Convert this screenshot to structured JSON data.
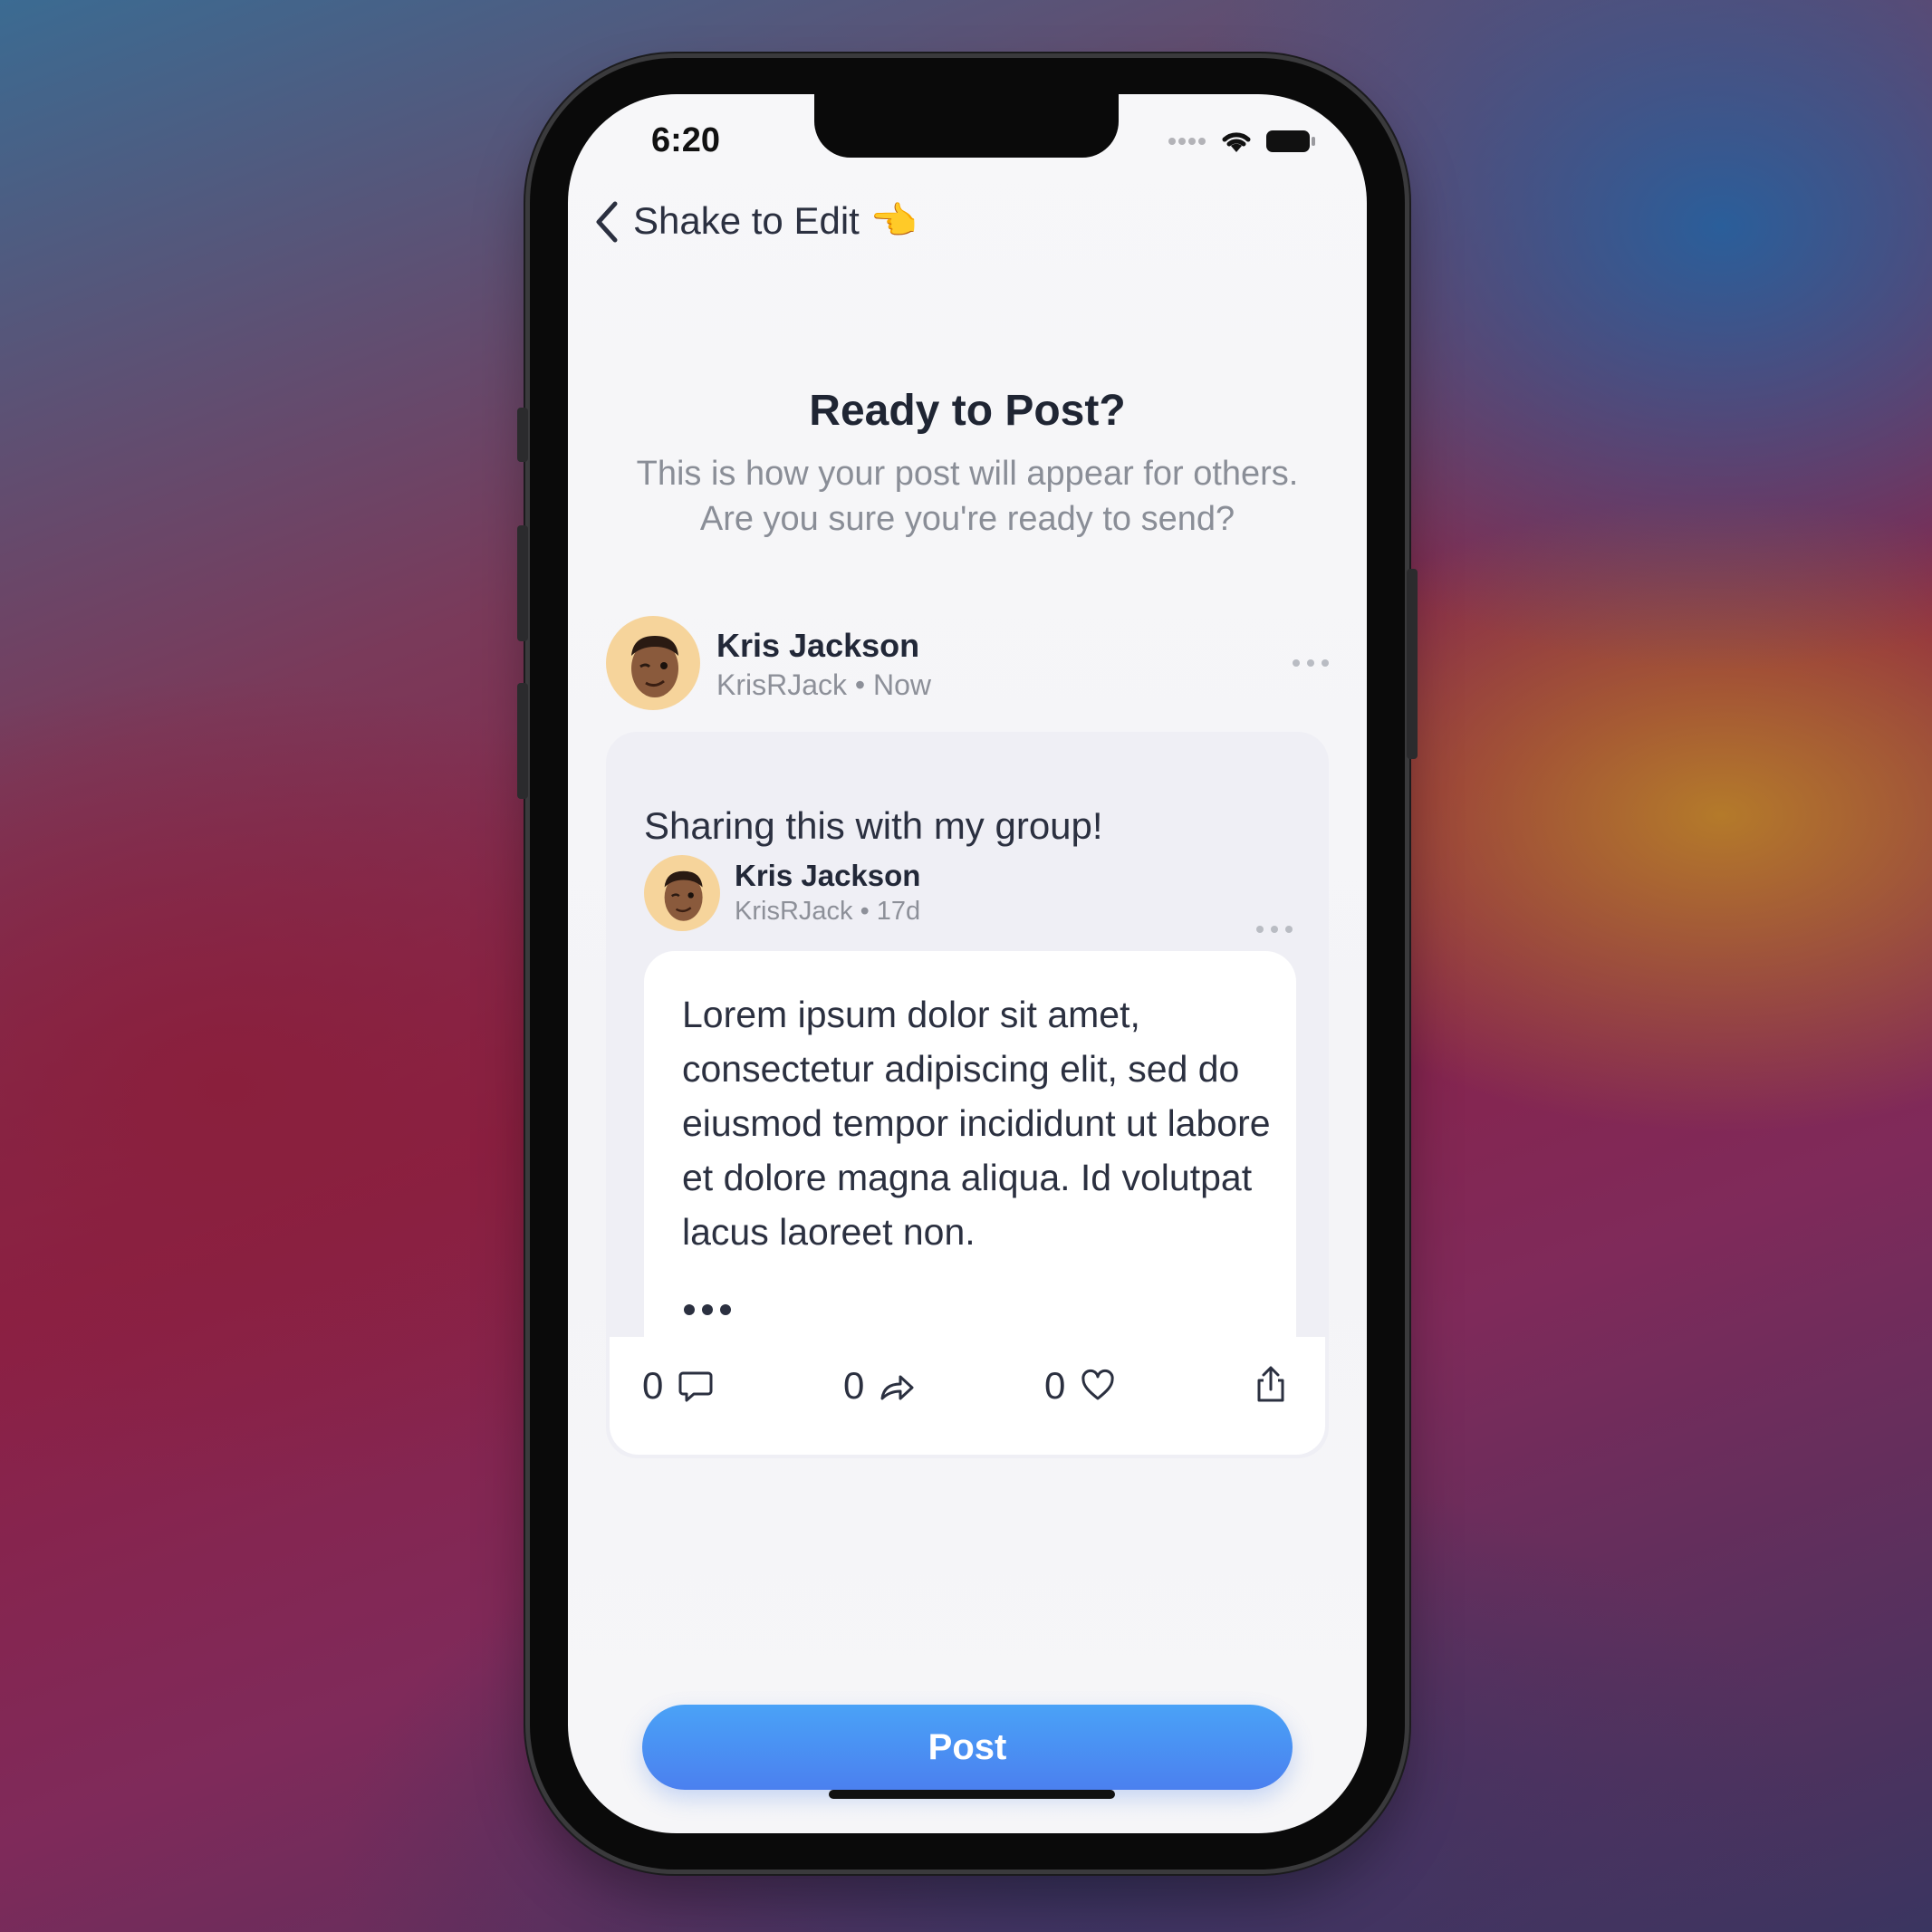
{
  "status": {
    "time": "6:20"
  },
  "nav": {
    "back_label": "Shake to Edit 👈"
  },
  "header": {
    "title": "Ready to Post?",
    "subtitle_line1": "This is how your post will appear for others.",
    "subtitle_line2": "Are you sure you're ready to send?"
  },
  "post": {
    "author_name": "Kris Jackson",
    "author_meta": "KrisRJack • Now",
    "text": "Sharing this with my group!",
    "shared": {
      "author_name": "Kris Jackson",
      "author_meta": "KrisRJack • 17d",
      "body": "Lorem ipsum dolor sit amet, consectetur adipiscing elit, sed do eiusmod tempor incididunt ut labore et dolore magna aliqua. Id volutpat lacus laoreet non."
    },
    "actions": {
      "comments": "0",
      "reposts": "0",
      "likes": "0"
    }
  },
  "post_button": {
    "label": "Post"
  },
  "colors": {
    "accent": "#4b8ef2",
    "avatar_bg": "#f6d49b",
    "card_bg": "#efeff5",
    "text_dark": "#2b3040",
    "text_muted": "#8a8e97"
  },
  "icons": [
    "chevron-left-icon",
    "wifi-icon",
    "battery-icon",
    "signal-dots-icon",
    "more-dots-icon",
    "comment-icon",
    "repost-icon",
    "heart-icon",
    "share-icon",
    "avatar-memoji"
  ]
}
